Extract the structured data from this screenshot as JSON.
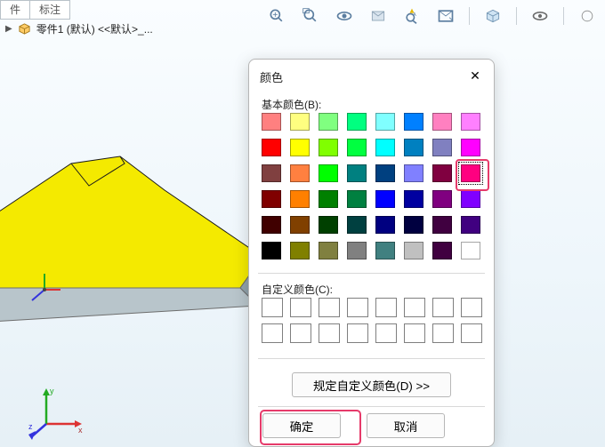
{
  "tabs": {
    "t0": "﻿件",
    "t1": "标注"
  },
  "tree": {
    "item": "零件1 (默认) <<默认>_..."
  },
  "dialog": {
    "title": "颜色",
    "basic_label": "基本颜色(B):",
    "custom_label": "自定义颜色(C):",
    "define_btn": "规定自定义颜色(D) >>",
    "ok": "确定",
    "cancel": "取消",
    "close": "✕"
  },
  "colors": {
    "rows": [
      [
        "#ff8080",
        "#ffff80",
        "#80ff80",
        "#00ff80",
        "#80ffff",
        "#0080ff",
        "#ff80c0",
        "#ff80ff"
      ],
      [
        "#ff0000",
        "#ffff00",
        "#80ff00",
        "#00ff40",
        "#00ffff",
        "#0080c0",
        "#8080c0",
        "#ff00ff"
      ],
      [
        "#804040",
        "#ff8040",
        "#00ff00",
        "#008080",
        "#004080",
        "#8080ff",
        "#800040",
        "#ff0080"
      ],
      [
        "#800000",
        "#ff8000",
        "#008000",
        "#008040",
        "#0000ff",
        "#0000a0",
        "#800080",
        "#8000ff"
      ],
      [
        "#400000",
        "#804000",
        "#004000",
        "#004040",
        "#000080",
        "#000040",
        "#400040",
        "#400080"
      ],
      [
        "#000000",
        "#808000",
        "#808040",
        "#808080",
        "#408080",
        "#c0c0c0",
        "#400040",
        "#ffffff"
      ]
    ],
    "selected_row": 2,
    "selected_col": 7
  },
  "triad": {
    "x": "x",
    "y": "y",
    "z": "z"
  }
}
